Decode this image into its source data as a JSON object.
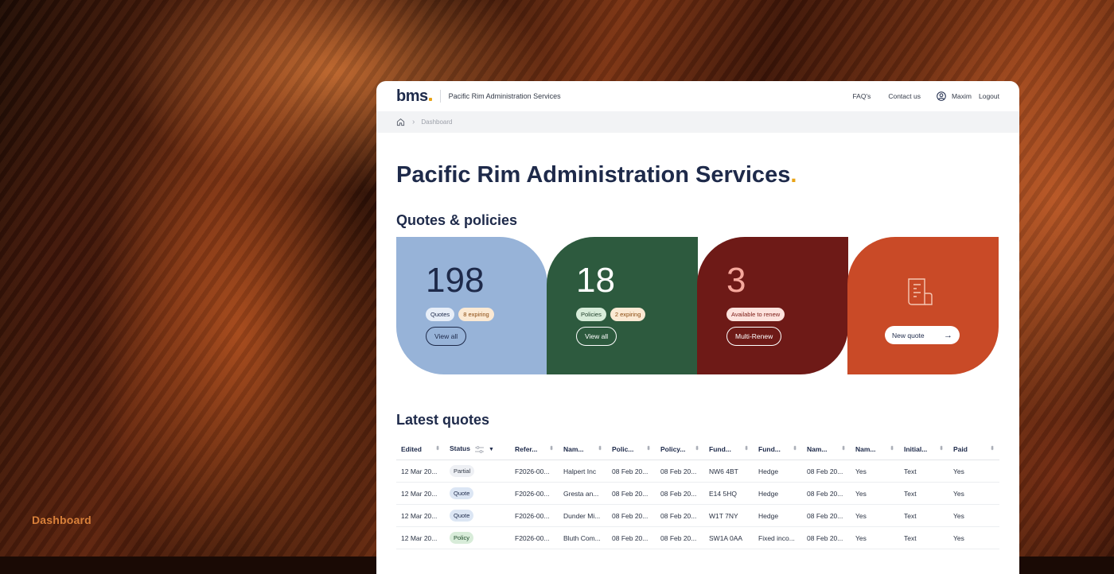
{
  "sidebar_label": "Dashboard",
  "header": {
    "logo": "bms",
    "org_name": "Pacific Rim Administration Services",
    "faqs": "FAQ's",
    "contact": "Contact us",
    "user": "Maxim",
    "logout": "Logout"
  },
  "breadcrumb": {
    "current": "Dashboard"
  },
  "page_title": "Pacific Rim Administration Services",
  "quotes_section": {
    "title": "Quotes & policies",
    "cards": [
      {
        "number": "198",
        "pill1": "Quotes",
        "pill2": "8 expiring",
        "button": "View all"
      },
      {
        "number": "18",
        "pill1": "Policies",
        "pill2": "2 expiring",
        "button": "View all"
      },
      {
        "number": "3",
        "pill1": "Available to renew",
        "button": "Multi-Renew"
      },
      {
        "button": "New quote"
      }
    ]
  },
  "latest_quotes": {
    "title": "Latest quotes",
    "columns": [
      "Edited",
      "Status",
      "Refer...",
      "Nam...",
      "Polic...",
      "Policy...",
      "Fund...",
      "Fund...",
      "Nam...",
      "Nam...",
      "Initial...",
      "Paid"
    ],
    "rows": [
      [
        "12 Mar 20...",
        "Partial",
        "F2026-00...",
        "Halpert Inc",
        "08 Feb 20...",
        "08 Feb 20...",
        "NW6 4BT",
        "Hedge",
        "08 Feb 20...",
        "Yes",
        "Text",
        "Yes"
      ],
      [
        "12 Mar 20...",
        "Quote",
        "F2026-00...",
        "Gresta an...",
        "08 Feb 20...",
        "08 Feb 20...",
        "E14 5HQ",
        "Hedge",
        "08 Feb 20...",
        "Yes",
        "Text",
        "Yes"
      ],
      [
        "12 Mar 20...",
        "Quote",
        "F2026-00...",
        "Dunder Mi...",
        "08 Feb 20...",
        "08 Feb 20...",
        "W1T 7NY",
        "Hedge",
        "08 Feb 20...",
        "Yes",
        "Text",
        "Yes"
      ],
      [
        "12 Mar 20...",
        "Policy",
        "F2026-00...",
        "Bluth Com...",
        "08 Feb 20...",
        "08 Feb 20...",
        "SW1A 0AA",
        "Fixed inco...",
        "08 Feb 20...",
        "Yes",
        "Text",
        "Yes"
      ]
    ]
  },
  "colors": {
    "accent": "#e8a317",
    "navy": "#1e2a4a",
    "card_blue": "#97b3d8",
    "card_green": "#2d5a3e",
    "card_maroon": "#6e1a17",
    "card_orange": "#c94a27"
  }
}
